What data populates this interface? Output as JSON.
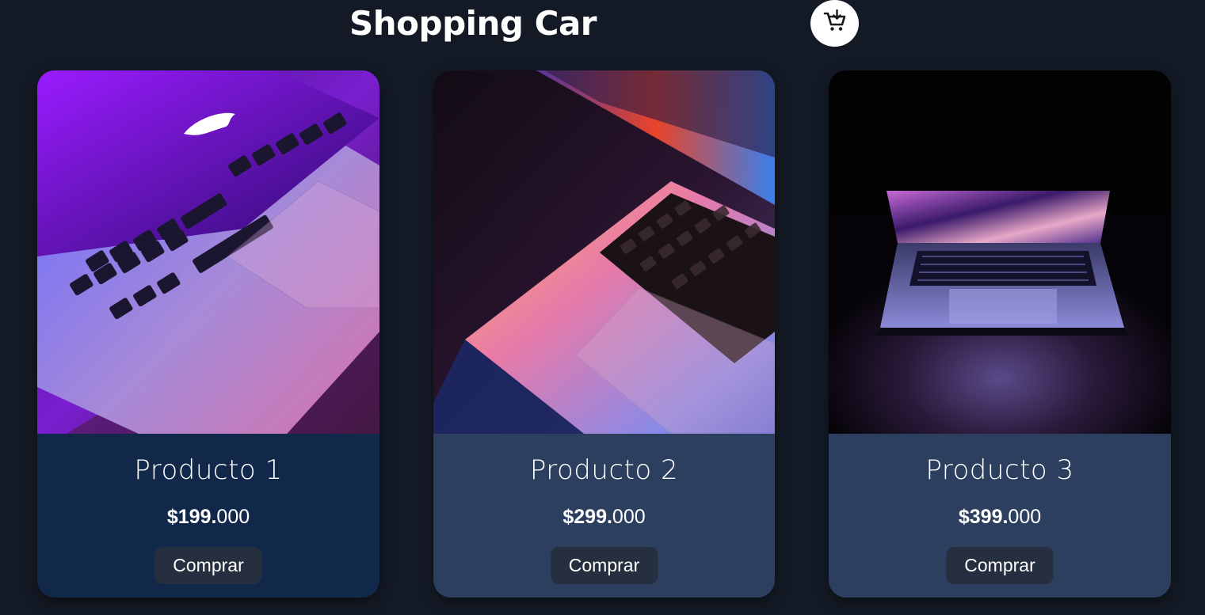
{
  "header": {
    "title": "Shopping Car",
    "cart_icon": "cart-add-icon"
  },
  "products": [
    {
      "name": "Producto 1",
      "price_main": "$199.",
      "price_cents": "000",
      "button_label": "Comprar",
      "image": "laptop-purple-keyboard-photo"
    },
    {
      "name": "Producto 2",
      "price_main": "$299.",
      "price_cents": "000",
      "button_label": "Comprar",
      "image": "laptop-orange-glow-photo"
    },
    {
      "name": "Producto 3",
      "price_main": "$399.",
      "price_cents": "000",
      "button_label": "Comprar",
      "image": "laptop-dark-open-photo"
    }
  ],
  "colors": {
    "background": "#141a25",
    "card_active": "#11284b",
    "card": "#2c3f5e",
    "button": "#252f3f",
    "text": "#ffffff"
  }
}
